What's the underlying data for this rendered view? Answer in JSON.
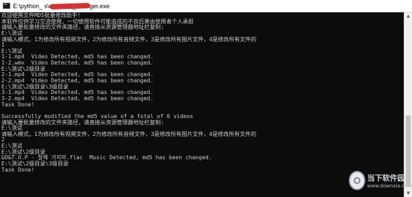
{
  "window": {
    "title": "E:\\python_              s\\dist\\md5_changer.exe"
  },
  "console": {
    "lines": [
      "欢迎使用文件MD5批量修改助手!",
      "本软件仅供学习交流使用，一切使用软件可能造成的不良后果由使用者个人承担",
      "请输入要批量修改的文件夹路径，请直接从资源管理器地址栏复制:",
      "E:\\测试",
      "请输入模式，1为修改所有视频文件，2为修改所有音频文件，3是修改所有图片文件，4是修改所有文件的",
      "1",
      "E:\\测试",
      "1-1.mp4  Video Detected, md5 has been changed.",
      "1-2.wmv  Video Detected, md5 has been changed.",
      "E:\\测试\\2级目录",
      "2-1.mp4  Video Detected, md5 has been changed.",
      "2-2.mp4  Video Detected, md5 has been changed.",
      "E:\\测试\\2级目录\\3级目录",
      "3-1.mp4  Video Detected, md5 has been changed.",
      "3-2.mp4  Video Detected, md5 has been changed.",
      "Task Done!",
      "",
      "Successfully modified the md5 value of a total of 6 videos",
      "请输入要批量修改的文件夹路径，请直接从资源管理器地址栏复制:",
      "E:\\测试",
      "请输入模式，1为修改所有视频文件，2为修改所有音频文件，3是修改所有图片文件，4是修改所有文件的",
      "2",
      "E:\\测试",
      "E:\\测试\\2级目录",
      "GD&T.O.P - 찰예 가지마.flac  Music Detected, md5 has been changed.",
      "E:\\测试\\2级目录\\3级目录",
      "Task Done!"
    ]
  },
  "watermark": {
    "name": "当下软件园",
    "url": "www.downxia.com"
  },
  "colors": {
    "console_bg": "#0c0c0c",
    "console_text": "#cccccc",
    "titlebar_bg": "#ffffff",
    "redaction": "#d12a2a"
  },
  "icons": {
    "app": "console-app-icon",
    "scroll_up": "arrow-up-icon",
    "scroll_down": "arrow-down-icon",
    "watermark": "downxia-logo-icon"
  }
}
